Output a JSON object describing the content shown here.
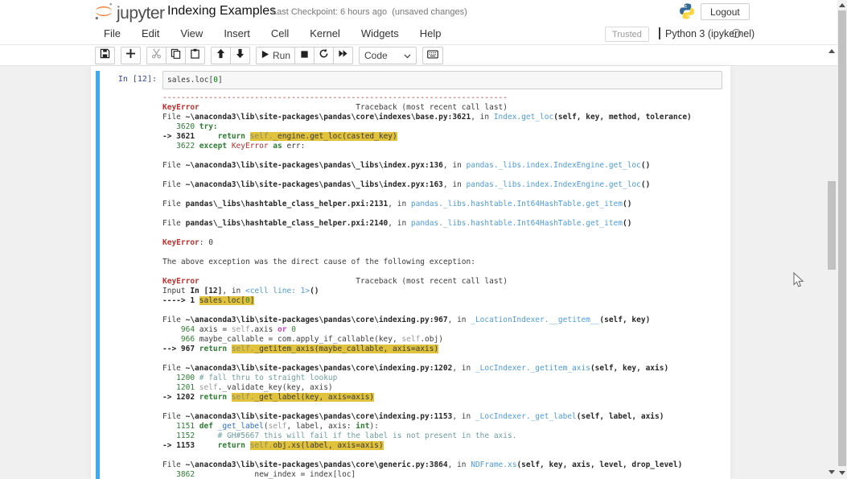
{
  "header": {
    "logo_text": "jupyter",
    "title": "Indexing Examples",
    "checkpoint": "Last Checkpoint: 6 hours ago",
    "unsaved": "(unsaved changes)",
    "logout_label": "Logout"
  },
  "menubar": {
    "items": [
      "File",
      "Edit",
      "View",
      "Insert",
      "Cell",
      "Kernel",
      "Widgets",
      "Help"
    ],
    "trusted_label": "Trusted",
    "kernel_name": "Python 3 (ipykernel)"
  },
  "toolbar": {
    "run_label": "Run",
    "cell_type": "Code",
    "icons": [
      "save-icon",
      "add-cell-icon",
      "cut-icon",
      "copy-icon",
      "paste-icon",
      "move-up-icon",
      "move-down-icon",
      "run-icon",
      "stop-icon",
      "restart-icon",
      "restart-run-all-icon",
      "keyboard-icon"
    ]
  },
  "colors": {
    "selected_cell_accent": "#42a5f5",
    "error_red": "#b8312f",
    "highlight_yellow": "#e0c23c",
    "prompt_blue": "#303f9f",
    "jupyter_orange": "#f37726"
  },
  "cell": {
    "prompt": "In [12]:",
    "input_segments": [
      [
        "dark",
        "sales.loc["
      ],
      [
        "num",
        "0"
      ],
      [
        "dark",
        "]"
      ]
    ]
  },
  "traceback": {
    "lines": [
      [
        [
          "red",
          "---------------------------------------------------------------------------"
        ]
      ],
      [
        [
          "redb",
          "KeyError"
        ],
        [
          "dark",
          "                                  Traceback (most recent call last)"
        ]
      ],
      [
        [
          "dark",
          "File "
        ],
        [
          "darkb",
          "~\\anaconda3\\lib\\site-packages\\pandas\\core\\indexes\\base.py:3621"
        ],
        [
          "dark",
          ", in "
        ],
        [
          "blue",
          "Index.get_loc"
        ],
        [
          "darkb",
          "(self, key, method, tolerance)"
        ]
      ],
      [
        [
          "green",
          "   3620 "
        ],
        [
          "greenb",
          "try:"
        ]
      ],
      [
        [
          "darkb",
          "-> 3621"
        ],
        [
          "dark",
          "     "
        ],
        [
          "greenb",
          "return "
        ],
        [
          "hlself",
          "self."
        ],
        [
          "hl",
          "_engine.get_loc(casted_key)"
        ]
      ],
      [
        [
          "green",
          "   3622 "
        ],
        [
          "greenb",
          "except "
        ],
        [
          "red",
          "KeyError "
        ],
        [
          "greenb",
          "as "
        ],
        [
          "dark",
          "err:"
        ]
      ],
      [],
      [
        [
          "dark",
          "File "
        ],
        [
          "darkb",
          "~\\anaconda3\\lib\\site-packages\\pandas\\_libs\\index.pyx:136"
        ],
        [
          "dark",
          ", in "
        ],
        [
          "blue",
          "pandas._libs.index.IndexEngine.get_loc"
        ],
        [
          "darkb",
          "()"
        ]
      ],
      [],
      [
        [
          "dark",
          "File "
        ],
        [
          "darkb",
          "~\\anaconda3\\lib\\site-packages\\pandas\\_libs\\index.pyx:163"
        ],
        [
          "dark",
          ", in "
        ],
        [
          "blue",
          "pandas._libs.index.IndexEngine.get_loc"
        ],
        [
          "darkb",
          "()"
        ]
      ],
      [],
      [
        [
          "dark",
          "File "
        ],
        [
          "darkb",
          "pandas\\_libs\\hashtable_class_helper.pxi:2131"
        ],
        [
          "dark",
          ", in "
        ],
        [
          "blue",
          "pandas._libs.hashtable.Int64HashTable.get_item"
        ],
        [
          "darkb",
          "()"
        ]
      ],
      [],
      [
        [
          "dark",
          "File "
        ],
        [
          "darkb",
          "pandas\\_libs\\hashtable_class_helper.pxi:2140"
        ],
        [
          "dark",
          ", in "
        ],
        [
          "blue",
          "pandas._libs.hashtable.Int64HashTable.get_item"
        ],
        [
          "darkb",
          "()"
        ]
      ],
      [],
      [
        [
          "redb",
          "KeyError"
        ],
        [
          "dark",
          ": 0"
        ]
      ],
      [],
      [
        [
          "dark",
          "The above exception was the direct cause of the following exception:"
        ]
      ],
      [],
      [
        [
          "redb",
          "KeyError"
        ],
        [
          "dark",
          "                                  Traceback (most recent call last)"
        ]
      ],
      [
        [
          "dark",
          "Input "
        ],
        [
          "darkb",
          "In [12]"
        ],
        [
          "dark",
          ", in "
        ],
        [
          "blue",
          "<cell line: 1>"
        ],
        [
          "darkb",
          "()"
        ]
      ],
      [
        [
          "darkb",
          "----> 1 "
        ],
        [
          "hl",
          "sales.loc["
        ],
        [
          "hlnum",
          "0"
        ],
        [
          "hl",
          "]"
        ]
      ],
      [],
      [
        [
          "dark",
          "File "
        ],
        [
          "darkb",
          "~\\anaconda3\\lib\\site-packages\\pandas\\core\\indexing.py:967"
        ],
        [
          "dark",
          ", in "
        ],
        [
          "blue",
          "_LocationIndexer.__getitem__"
        ],
        [
          "darkb",
          "(self, key)"
        ]
      ],
      [
        [
          "green",
          "    964 "
        ],
        [
          "dark",
          "axis = "
        ],
        [
          "self",
          "self"
        ],
        [
          "dark",
          ".axis "
        ],
        [
          "mag",
          "or "
        ],
        [
          "green",
          "0"
        ]
      ],
      [
        [
          "green",
          "    966 "
        ],
        [
          "dark",
          "maybe_callable = com.apply_if_callable(key, "
        ],
        [
          "self",
          "self"
        ],
        [
          "dark",
          ".obj)"
        ]
      ],
      [
        [
          "darkb",
          "--> 967 "
        ],
        [
          "greenb",
          "return "
        ],
        [
          "hlself",
          "self."
        ],
        [
          "hl",
          "_getitem_axis(maybe_callable, axis=axis)"
        ]
      ],
      [],
      [
        [
          "dark",
          "File "
        ],
        [
          "darkb",
          "~\\anaconda3\\lib\\site-packages\\pandas\\core\\indexing.py:1202"
        ],
        [
          "dark",
          ", in "
        ],
        [
          "blue",
          "_LocIndexer._getitem_axis"
        ],
        [
          "darkb",
          "(self, key, axis)"
        ]
      ],
      [
        [
          "green",
          "   1200 "
        ],
        [
          "com",
          "# fall thru to straight lookup"
        ]
      ],
      [
        [
          "green",
          "   1201 "
        ],
        [
          "self",
          "self"
        ],
        [
          "dark",
          "._validate_key(key, axis)"
        ]
      ],
      [
        [
          "darkb",
          "-> 1202 "
        ],
        [
          "greenb",
          "return "
        ],
        [
          "hlself",
          "self."
        ],
        [
          "hl",
          "_get_label(key, axis=axis)"
        ]
      ],
      [],
      [
        [
          "dark",
          "File "
        ],
        [
          "darkb",
          "~\\anaconda3\\lib\\site-packages\\pandas\\core\\indexing.py:1153"
        ],
        [
          "dark",
          ", in "
        ],
        [
          "blue",
          "_LocIndexer._get_label"
        ],
        [
          "darkb",
          "(self, label, axis)"
        ]
      ],
      [
        [
          "green",
          "   1151 "
        ],
        [
          "greenb",
          "def "
        ],
        [
          "def",
          "_get_label"
        ],
        [
          "dark",
          "("
        ],
        [
          "self",
          "self"
        ],
        [
          "dark",
          ", label, axis: "
        ],
        [
          "greenb",
          "int"
        ],
        [
          "dark",
          "):"
        ]
      ],
      [
        [
          "green",
          "   1152 "
        ],
        [
          "com",
          "    # GH#5667 this will fail if the label is not present in the axis."
        ]
      ],
      [
        [
          "darkb",
          "-> 1153"
        ],
        [
          "dark",
          "     "
        ],
        [
          "greenb",
          "return "
        ],
        [
          "hlself",
          "self."
        ],
        [
          "hl",
          "obj.xs(label, axis=axis)"
        ]
      ],
      [],
      [
        [
          "dark",
          "File "
        ],
        [
          "darkb",
          "~\\anaconda3\\lib\\site-packages\\pandas\\core\\generic.py:3864"
        ],
        [
          "dark",
          ", in "
        ],
        [
          "blue",
          "NDFrame.xs"
        ],
        [
          "darkb",
          "(self, key, axis, level, drop_level)"
        ]
      ],
      [
        [
          "green",
          "   3862 "
        ],
        [
          "dark",
          "            new_index = index[loc]"
        ]
      ]
    ]
  }
}
